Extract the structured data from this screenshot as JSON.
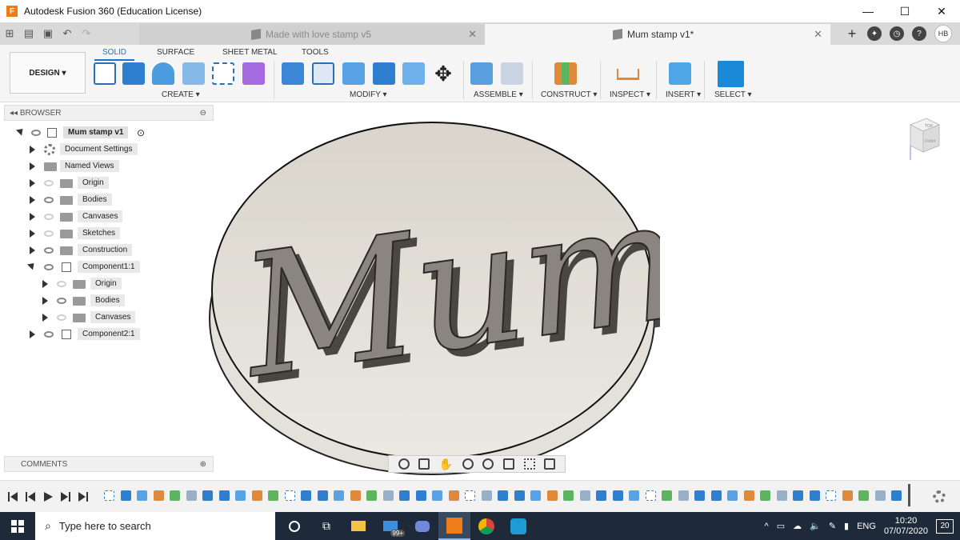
{
  "window": {
    "title": "Autodesk Fusion 360 (Education License)",
    "logo_letter": "F",
    "controls": {
      "minimize": "—",
      "maximize": "☐",
      "close": "✕"
    }
  },
  "tabs": [
    {
      "label": "Made with love stamp v5",
      "active": false
    },
    {
      "label": "Mum stamp v1*",
      "active": true
    }
  ],
  "user_initials": "HB",
  "toolbar": {
    "workspace": "DESIGN",
    "ribbon_tabs": [
      "SOLID",
      "SURFACE",
      "SHEET METAL",
      "TOOLS"
    ],
    "groups": {
      "create": "CREATE",
      "modify": "MODIFY",
      "assemble": "ASSEMBLE",
      "construct": "CONSTRUCT",
      "inspect": "INSPECT",
      "insert": "INSERT",
      "select": "SELECT"
    }
  },
  "browser": {
    "title": "BROWSER",
    "root": "Mum stamp v1",
    "items": {
      "document_settings": "Document Settings",
      "named_views": "Named Views",
      "origin": "Origin",
      "bodies": "Bodies",
      "canvases": "Canvases",
      "sketches": "Sketches",
      "construction": "Construction",
      "component1": "Component1:1",
      "c1_origin": "Origin",
      "c1_bodies": "Bodies",
      "c1_canvases": "Canvases",
      "component2": "Component2:1"
    }
  },
  "comments": "COMMENTS",
  "viewcube": {
    "top": "TOP",
    "front": "FRONT"
  },
  "viewport": {
    "text": "Mum",
    "background": "#ffffff"
  },
  "taskbar": {
    "search_placeholder": "Type here to search",
    "mail_badge": "99+",
    "language": "ENG",
    "time": "10:20",
    "date": "07/07/2020",
    "notifications": "20"
  },
  "colors": {
    "accent": "#1a73c9",
    "taskbar": "#1e2a3a"
  }
}
